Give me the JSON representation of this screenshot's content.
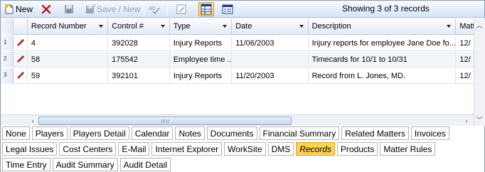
{
  "toolbar": {
    "new_label": "New",
    "save_new_label": "Save / New",
    "records_status": "Showing 3 of 3 records"
  },
  "grid": {
    "columns": [
      "Record Number",
      "Control #",
      "Type",
      "Date",
      "Description",
      "Matter"
    ],
    "rows": [
      {
        "num": "1",
        "record": "4",
        "control": "392028",
        "type": "Injury Reports",
        "date": "11/06/2003",
        "description": "Injury reports for employee Jane Doe fo...",
        "matter": "12/"
      },
      {
        "num": "2",
        "record": "58",
        "control": "175542",
        "type": "Employee time ...",
        "date": "",
        "description": "Timecards for 10/1 to 10/31",
        "matter": "12/"
      },
      {
        "num": "3",
        "record": "59",
        "control": "392101",
        "type": "Injury Reports",
        "date": "11/20/2003",
        "description": "Record from L. Jones, MD.",
        "matter": "12/"
      }
    ]
  },
  "tabs": {
    "row1": [
      "None",
      "Players",
      "Players Detail",
      "Calendar",
      "Notes",
      "Documents",
      "Financial Summary",
      "Related Matters",
      "Invoices"
    ],
    "row2": [
      "Legal Issues",
      "Cost Centers",
      "E-Mail",
      "Internet Explorer",
      "WorkSite",
      "DMS",
      "Records",
      "Products",
      "Matter Rules"
    ],
    "row3": [
      "Time Entry",
      "Audit Summary",
      "Audit Detail"
    ],
    "active": "Records"
  },
  "colors": {
    "accent_tab": "#ffd24d",
    "toolbar_top": "#f7fbff",
    "toolbar_bottom": "#d6e4f5"
  },
  "icons": [
    "new-document-icon",
    "delete-x-icon",
    "save-disk-icon",
    "save-new-disk-icon",
    "spellcheck-icon",
    "edit-form-icon",
    "grid-view-icon",
    "form-view-icon",
    "pencil-icon"
  ]
}
